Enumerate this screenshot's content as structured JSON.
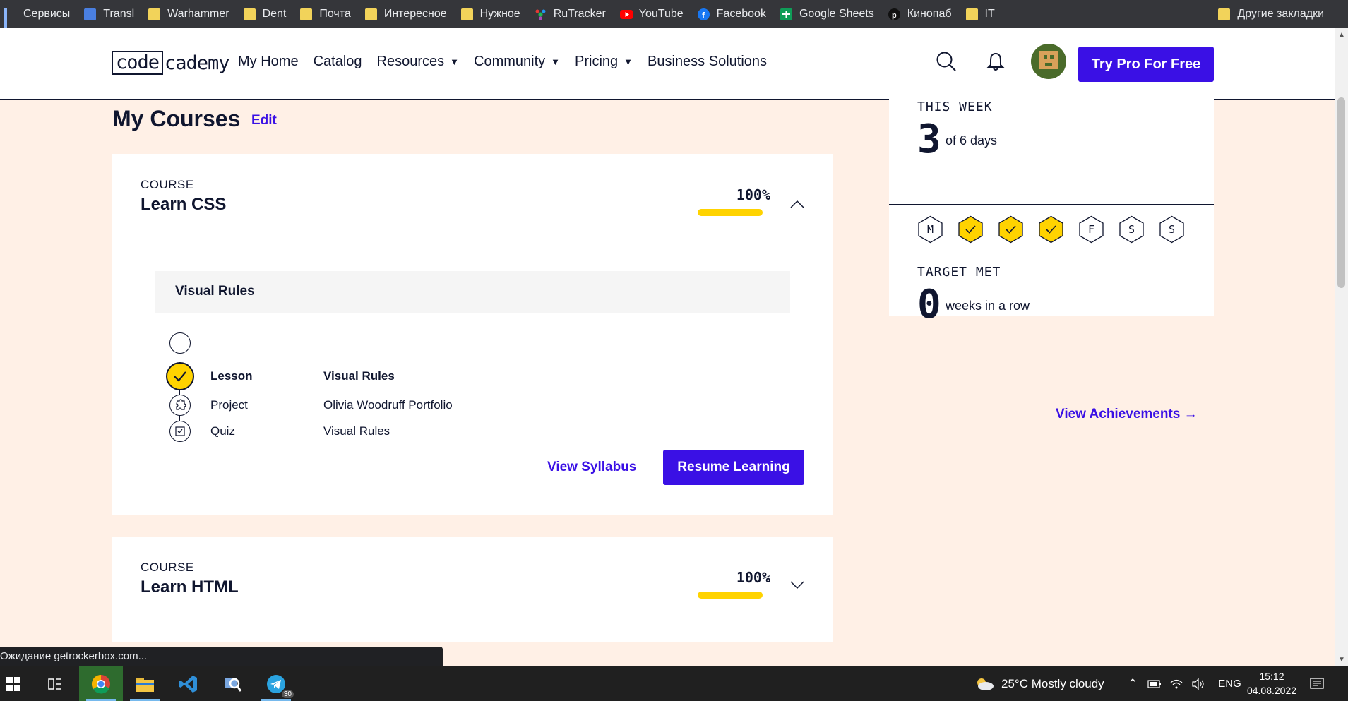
{
  "bookmarks": {
    "items": [
      {
        "label": "Сервисы",
        "icon": "apps-grid-icon"
      },
      {
        "label": "Transl",
        "icon": "translate-icon"
      },
      {
        "label": "Warhammer",
        "icon": "folder-icon"
      },
      {
        "label": "Dent",
        "icon": "folder-icon"
      },
      {
        "label": "Почта",
        "icon": "folder-icon"
      },
      {
        "label": "Интересное",
        "icon": "folder-icon"
      },
      {
        "label": "Нужное",
        "icon": "folder-icon"
      },
      {
        "label": "RuTracker",
        "icon": "rutracker-icon"
      },
      {
        "label": "YouTube",
        "icon": "youtube-icon"
      },
      {
        "label": "Facebook",
        "icon": "facebook-icon"
      },
      {
        "label": "Google Sheets",
        "icon": "sheets-icon"
      },
      {
        "label": "Кинопаб",
        "icon": "kinopub-icon"
      },
      {
        "label": "IT",
        "icon": "folder-icon"
      }
    ],
    "other": "Другие закладки"
  },
  "header": {
    "logo_box": "code",
    "logo_rest": "cademy",
    "nav": [
      {
        "label": "My Home",
        "caret": false
      },
      {
        "label": "Catalog",
        "caret": false
      },
      {
        "label": "Resources",
        "caret": true
      },
      {
        "label": "Community",
        "caret": true
      },
      {
        "label": "Pricing",
        "caret": true
      },
      {
        "label": "Business Solutions",
        "caret": false
      }
    ],
    "caret_glyph": "▼",
    "pro_button": "Try Pro For Free"
  },
  "main": {
    "title": "My Courses",
    "edit": "Edit",
    "courses": [
      {
        "tag": "COURSE",
        "name": "Learn CSS",
        "progress_label": "100%",
        "progress": 1.0,
        "expanded": true,
        "module": "Visual Rules",
        "items": [
          {
            "kind": "Lesson",
            "title": "Visual Rules",
            "done": true,
            "icon": "check-icon"
          },
          {
            "kind": "Project",
            "title": "Olivia Woodruff Portfolio",
            "done": false,
            "icon": "puzzle-icon"
          },
          {
            "kind": "Quiz",
            "title": "Visual Rules",
            "done": false,
            "icon": "quiz-icon"
          }
        ],
        "syllabus": "View Syllabus",
        "resume": "Resume Learning"
      },
      {
        "tag": "COURSE",
        "name": "Learn HTML",
        "progress_label": "100%",
        "progress": 1.0,
        "expanded": false
      }
    ]
  },
  "stats": {
    "week_label": "THIS WEEK",
    "week_value": "3",
    "week_sub": "of 6 days",
    "days": [
      {
        "letter": "M",
        "done": false
      },
      {
        "letter": "",
        "done": true
      },
      {
        "letter": "",
        "done": true
      },
      {
        "letter": "",
        "done": true
      },
      {
        "letter": "F",
        "done": false
      },
      {
        "letter": "S",
        "done": false
      },
      {
        "letter": "S",
        "done": false
      }
    ],
    "target_label": "TARGET MET",
    "target_value": "0",
    "target_sub": "weeks in a row",
    "achievements": "View Achievements →"
  },
  "status_bar": "Ожидание getrockerbox.com...",
  "taskbar": {
    "telegram_badge": "30",
    "weather": "25°C  Mostly cloudy",
    "lang": "ENG",
    "time": "15:12",
    "date": "04.08.2022"
  },
  "colors": {
    "brand": "#3a10e5",
    "accent_yellow": "#ffd300",
    "page_bg": "#fff0e6",
    "navy": "#10162f"
  }
}
